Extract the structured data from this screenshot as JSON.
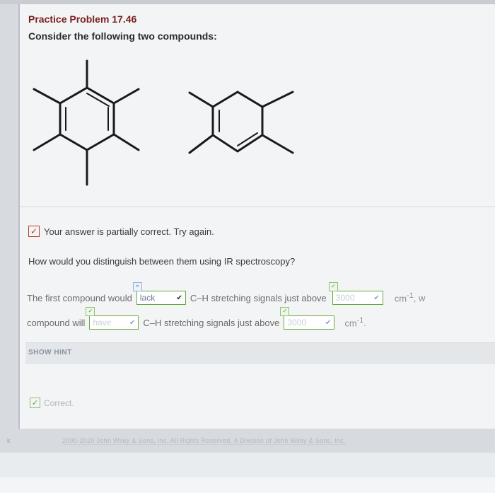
{
  "problem": {
    "title": "Practice Problem 17.46",
    "prompt": "Consider the following two compounds:"
  },
  "feedback": {
    "status_text": "Your answer is partially correct.  Try again.",
    "correct_label": "Correct."
  },
  "question": {
    "text": "How would you distinguish between them using IR spectroscopy?"
  },
  "answer": {
    "line1_prefix": "The first compound would",
    "sel1_value": "lack",
    "line1_middle": "C–H stretching signals just above",
    "sel2_value": "3000",
    "unit1": "cm",
    "unit1_sup": "-1",
    "line1_suffix": ", w",
    "line2_prefix": "compound will",
    "sel3_value": "have",
    "line2_middle": "C–H stretching signals just above",
    "sel4_value": "3000",
    "unit2": "cm",
    "unit2_sup": "-1",
    "line2_suffix": "."
  },
  "hint": {
    "label": "SHOW HINT"
  },
  "footer": {
    "back_label": "k",
    "copyright": "2000-2020 John Wiley & Sons, Inc. All Rights Reserved. A Division of John Wiley & Sons, Inc."
  },
  "icons": {
    "status": "partially-correct-icon",
    "correct": "checkmark-icon",
    "dropdown": "chevron-down-icon"
  },
  "colors": {
    "title": "#7a1e1e",
    "status_border": "#c0392b",
    "select_border": "#6aaa3c"
  }
}
